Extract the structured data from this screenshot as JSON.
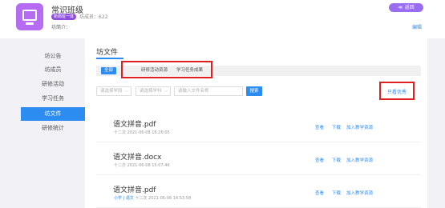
{
  "header": {
    "title": "常识班级",
    "tag": "新郎班一体",
    "visits_label": "坊成员：",
    "visits_value": "622",
    "intro": "坊简介：",
    "back_button": "≪ 返回",
    "edit_link": "编辑"
  },
  "sidebar": {
    "items": [
      {
        "label": "坊公告"
      },
      {
        "label": "坊成员"
      },
      {
        "label": "研修活动"
      },
      {
        "label": "学习任务"
      },
      {
        "label": "坊文件"
      },
      {
        "label": "研修统计"
      }
    ],
    "active_index": 4
  },
  "panel": {
    "title": "坊文件",
    "tabs": [
      {
        "label": "全部"
      },
      {
        "label": "研修活动资源"
      },
      {
        "label": "学习任务成果"
      }
    ],
    "filters": {
      "subject_placeholder": "请选择学段",
      "discipline_placeholder": "请选择学科",
      "name_placeholder": "请输入文件名称",
      "search_button": "搜索",
      "only_best": "只看优秀"
    },
    "files": [
      {
        "name": "语文拼音.pdf",
        "meta_prefix": "",
        "meta": "十二次  2021-06-08 16:26:05",
        "actions": [
          "查看",
          "下载",
          "加入教学资源"
        ]
      },
      {
        "name": "语文拼音.docx",
        "meta_prefix": "",
        "meta": "十二次  2021-06-08 15:07:46",
        "actions": [
          "查看",
          "下载",
          "加入教学资源"
        ]
      },
      {
        "name": "语文拼音.pdf",
        "meta_prefix": "小学 | 语文",
        "meta": "十二次  2021-06-08 14:53:58",
        "actions": [
          "查看",
          "下载",
          "加入教学资源"
        ]
      }
    ]
  },
  "colors": {
    "primary": "#2d8cf0",
    "accent_purple": "#9a6cf0",
    "highlight_red": "#e02020"
  }
}
